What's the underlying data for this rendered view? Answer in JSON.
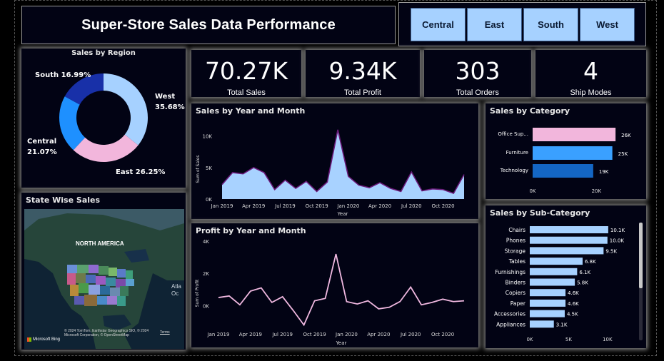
{
  "header": {
    "title": "Super-Store Sales Data Performance"
  },
  "slicer": {
    "regions": [
      "Central",
      "East",
      "South",
      "West"
    ]
  },
  "kpis": [
    {
      "value": "70.27K",
      "label": "Total Sales"
    },
    {
      "value": "9.34K",
      "label": "Total Profit"
    },
    {
      "value": "303",
      "label": "Total Orders"
    },
    {
      "value": "4",
      "label": "Ship Modes"
    }
  ],
  "colors": {
    "background": "#000000",
    "card": "#020314",
    "slicer_button": "#a6d1ff",
    "area_fill": "#a8d2ff",
    "area_line": "#6a1a7a",
    "profit_line": "#f0b8e0",
    "category_colors": [
      "#f2b6dc",
      "#3aa0ff",
      "#1466c4"
    ],
    "subcat_bar": "#a6d1ff",
    "donut": {
      "West": "#a6d1ff",
      "East": "#f2b6dc",
      "Central": "#1e90ff",
      "South": "#1830a8"
    }
  },
  "sales_by_region": {
    "title": "Sales by Region",
    "labels": {
      "south": "South 16.99%",
      "west": "West",
      "west_pct": "35.68%",
      "central": "Central",
      "central_pct": "21.07%",
      "east": "East 26.25%"
    },
    "chart_data": {
      "type": "pie",
      "categories": [
        "West",
        "East",
        "Central",
        "South"
      ],
      "values": [
        35.68,
        26.25,
        21.07,
        16.99
      ]
    }
  },
  "state_wise": {
    "title": "State Wise Sales",
    "map_label": "NORTH AMERICA",
    "ocean_label": "Atla\nOc",
    "credit": "© 2024 TomTom, Earthstar Geographics SIO, © 2024 Microsoft Corporation, © OpenStreetMap",
    "brand": "Microsoft Bing",
    "terms": "Terms"
  },
  "sales_by_month": {
    "title": "Sales by Year and Month",
    "ylabel": "Sum of Sales",
    "xlabel": "Year",
    "yticks": [
      "10K",
      "5K",
      "0K"
    ],
    "xticks": [
      "Jan 2019",
      "Apr 2019",
      "Jul 2019",
      "Oct 2019",
      "Jan 2020",
      "Apr 2020",
      "Jul 2020",
      "Oct 2020"
    ],
    "chart_data": {
      "type": "area",
      "x": [
        "Jan 2019",
        "Feb 2019",
        "Mar 2019",
        "Apr 2019",
        "May 2019",
        "Jun 2019",
        "Jul 2019",
        "Aug 2019",
        "Sep 2019",
        "Oct 2019",
        "Nov 2019",
        "Dec 2019",
        "Jan 2020",
        "Feb 2020",
        "Mar 2020",
        "Apr 2020",
        "May 2020",
        "Jun 2020",
        "Jul 2020",
        "Aug 2020",
        "Sep 2020",
        "Oct 2020",
        "Nov 2020",
        "Dec 2020"
      ],
      "y": [
        2300,
        4200,
        4000,
        5000,
        4200,
        1500,
        3000,
        1700,
        2800,
        1200,
        2700,
        11000,
        3600,
        2200,
        1800,
        2600,
        1700,
        1200,
        4300,
        1300,
        1600,
        1500,
        900,
        3900
      ],
      "ylim": [
        0,
        12000
      ]
    }
  },
  "profit_by_month": {
    "title": "Profit by Year and Month",
    "ylabel": "Sum of Profit",
    "xlabel": "Year",
    "yticks": [
      "4K",
      "2K",
      "0K"
    ],
    "xticks": [
      "Jan 2019",
      "Apr 2019",
      "Jul 2019",
      "Oct 2019",
      "Jan 2020",
      "Apr 2020",
      "Jul 2020",
      "Oct 2020"
    ],
    "chart_data": {
      "type": "line",
      "x": [
        "Jan 2019",
        "Feb 2019",
        "Mar 2019",
        "Apr 2019",
        "May 2019",
        "Jun 2019",
        "Jul 2019",
        "Aug 2019",
        "Sep 2019",
        "Oct 2019",
        "Nov 2019",
        "Dec 2019",
        "Jan 2020",
        "Feb 2020",
        "Mar 2020",
        "Apr 2020",
        "May 2020",
        "Jun 2020",
        "Jul 2020",
        "Aug 2020",
        "Sep 2020",
        "Oct 2020",
        "Nov 2020",
        "Dec 2020"
      ],
      "y": [
        500,
        600,
        50,
        900,
        1100,
        200,
        550,
        -300,
        -1200,
        300,
        450,
        3200,
        250,
        100,
        300,
        -200,
        -100,
        250,
        1150,
        50,
        200,
        400,
        250,
        300
      ],
      "ylim": [
        -1400,
        4000
      ]
    }
  },
  "sales_by_category": {
    "title": "Sales by Category",
    "xticks": [
      "0K",
      "20K"
    ],
    "chart_data": {
      "type": "bar",
      "categories": [
        "Office Sup...",
        "Furniture",
        "Technology"
      ],
      "values": [
        26,
        25,
        19
      ],
      "labels": [
        "26K",
        "25K",
        "19K"
      ],
      "xlim": [
        0,
        30
      ]
    }
  },
  "sales_by_subcategory": {
    "title": "Sales by Sub-Category",
    "xticks": [
      "0K",
      "5K",
      "10K"
    ],
    "chart_data": {
      "type": "bar",
      "categories": [
        "Chairs",
        "Phones",
        "Storage",
        "Tables",
        "Furnishings",
        "Binders",
        "Copiers",
        "Paper",
        "Accessories",
        "Appliances"
      ],
      "values": [
        10.1,
        10.0,
        9.5,
        6.8,
        6.1,
        5.8,
        4.6,
        4.6,
        4.5,
        3.1
      ],
      "labels": [
        "10.1K",
        "10.0K",
        "9.5K",
        "6.8K",
        "6.1K",
        "5.8K",
        "4.6K",
        "4.6K",
        "4.5K",
        "3.1K"
      ],
      "xlim": [
        0,
        12.5
      ]
    }
  }
}
